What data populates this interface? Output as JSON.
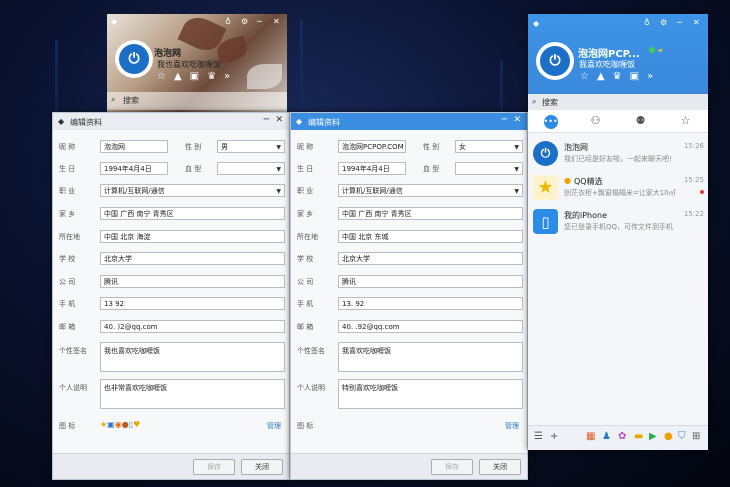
{
  "mini_panel": {
    "nickname": "泡泡网",
    "signature": "我也喜欢吃咖喱饭",
    "search_label": "搜索",
    "tool_icons": [
      "star-icon",
      "pyramid-icon",
      "gift-icon",
      "crown-icon",
      "more-icon"
    ]
  },
  "left_window": {
    "title": "编辑资料",
    "labels": {
      "nickname": "昵 称",
      "gender": "性 别",
      "birthday": "生 日",
      "blood": "血 型",
      "job": "职 业",
      "hometown": "家 乡",
      "location": "所在地",
      "school": "学 校",
      "company": "公 司",
      "phone": "手 机",
      "email": "邮 箱",
      "signature": "个性签名",
      "desc": "个人说明",
      "icons": "图 标"
    },
    "values": {
      "nickname": "泡泡网",
      "gender": "男",
      "birthday": "1994年4月4日",
      "blood": "",
      "job": "计算机/互联网/通信",
      "hometown": "中国 广西 南宁 青秀区",
      "location": "中国 北京 海淀",
      "school": "北京大学",
      "company": "腾讯",
      "phone": "13        92",
      "email": "40.      )2@qq.com",
      "signature": "我也喜欢吃咖喱饭",
      "desc": "也非常喜欢吃咖喱饭"
    },
    "manage": "管理",
    "save": "保存",
    "close": "关闭"
  },
  "right_window": {
    "title": "编辑资料",
    "labels": {
      "nickname": "昵 称",
      "gender": "性 别",
      "birthday": "生 日",
      "blood": "血 型",
      "job": "职 业",
      "hometown": "家 乡",
      "location": "所在地",
      "school": "学 校",
      "company": "公 司",
      "phone": "手 机",
      "email": "邮 箱",
      "signature": "个性签名",
      "desc": "个人说明",
      "icons": "图 标"
    },
    "values": {
      "nickname": "泡泡网PCPOP.COM",
      "gender": "女",
      "birthday": "1994年4月4日",
      "blood": "",
      "job": "计算机/互联网/通信",
      "hometown": "中国 广西 南宁 青秀区",
      "location": "中国 北京 东城",
      "school": "北京大学",
      "company": "腾讯",
      "phone": "13.        92",
      "email": "40.      .92@qq.com",
      "signature": "我喜欢吃咖喱饭",
      "desc": "特别喜欢吃咖喱饭"
    },
    "manage": "管理",
    "save": "保存",
    "close": "关闭"
  },
  "main_panel": {
    "nickname": "泡泡网PCP...",
    "signature": "我喜欢吃咖喱饭",
    "search_label": "搜索",
    "conversations": [
      {
        "name": "泡泡网",
        "msg": "我们已经是好友啦，一起来聊天吧!",
        "time": "15:26",
        "icon": "power-avatar"
      },
      {
        "name": "QQ精选",
        "msg": "别茫衣柜+飘窗榻榻米=让家大10㎡",
        "time": "15:25",
        "icon": "star-avatar"
      },
      {
        "name": "我的iPhone",
        "msg": "您已登录手机QQ，可传文件到手机",
        "time": "15:22",
        "icon": "phone-avatar"
      }
    ]
  },
  "colors": {
    "accent": "#3a8de0",
    "brand": "#1c6fc6"
  }
}
